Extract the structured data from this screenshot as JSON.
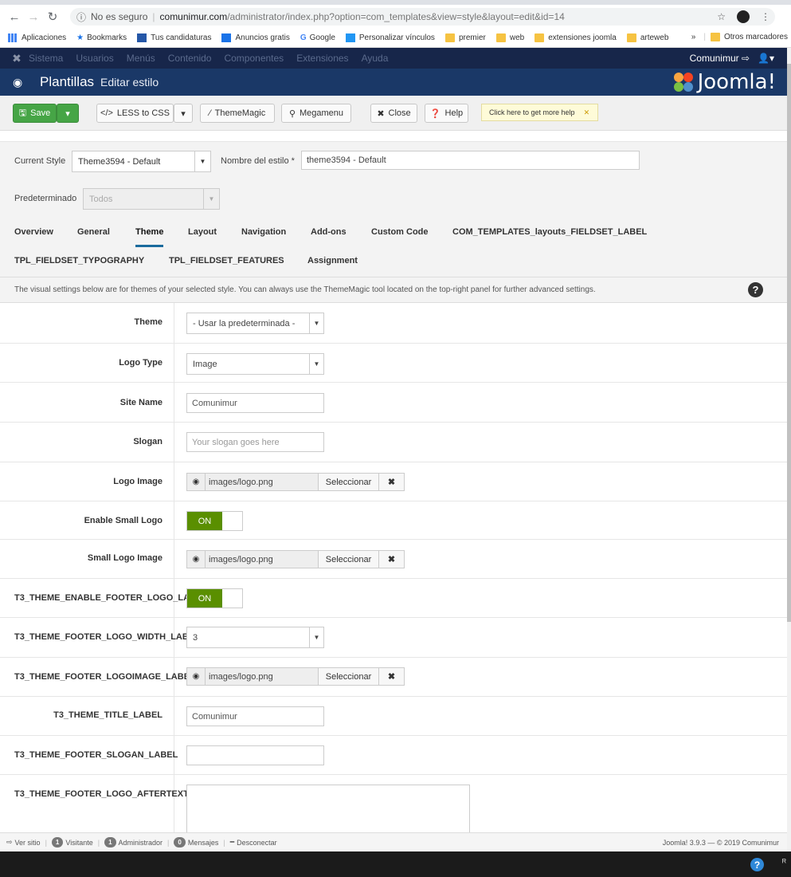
{
  "browser": {
    "url_warning": "No es seguro",
    "url_host": "comunimur.com",
    "url_path": "/administrator/index.php?option=com_templates&view=style&layout=edit&id=14",
    "bookmarks": [
      "Aplicaciones",
      "Bookmarks",
      "Tus candidaturas",
      "Anuncios gratis",
      "Google",
      "Personalizar vínculos",
      "premier",
      "web",
      "extensiones joomla",
      "arteweb"
    ],
    "more": "»",
    "other_bookmarks": "Otros marcadores"
  },
  "menu": {
    "items": [
      "Sistema",
      "Usuarios",
      "Menús",
      "Contenido",
      "Componentes",
      "Extensiones",
      "Ayuda"
    ],
    "user": "Comunimur"
  },
  "title": {
    "main": "Plantillas",
    "sub": "Editar estilo",
    "brand": "Joomla!"
  },
  "toolbar": {
    "save": "Save",
    "less": "LESS to CSS",
    "thememagic": "ThemeMagic",
    "megamenu": "Megamenu",
    "close": "Close",
    "help": "Help",
    "tip": "Click here to get more help"
  },
  "style": {
    "current_label": "Current Style",
    "current_value": "Theme3594 - Default",
    "name_label": "Nombre del estilo *",
    "name_value": "theme3594 - Default",
    "default_label": "Predeterminado",
    "default_value": "Todos"
  },
  "tabs": [
    "Overview",
    "General",
    "Theme",
    "Layout",
    "Navigation",
    "Add-ons",
    "Custom Code",
    "COM_TEMPLATES_layouts_FIELDSET_LABEL",
    "TPL_FIELDSET_TYPOGRAPHY",
    "TPL_FIELDSET_FEATURES",
    "Assignment"
  ],
  "notice": "The visual settings below are for themes of your selected style. You can always use the ThemeMagic tool located on the top-right panel for further advanced settings.",
  "fields": {
    "theme": {
      "label": "Theme",
      "value": "- Usar la predeterminada -"
    },
    "logo_type": {
      "label": "Logo Type",
      "value": "Image"
    },
    "site_name": {
      "label": "Site Name",
      "value": "Comunimur"
    },
    "slogan": {
      "label": "Slogan",
      "placeholder": "Your slogan goes here"
    },
    "logo_image": {
      "label": "Logo Image",
      "value": "images/logo.png"
    },
    "enable_small_logo": {
      "label": "Enable Small Logo",
      "value": "ON"
    },
    "small_logo_image": {
      "label": "Small Logo Image",
      "value": "images/logo.png"
    },
    "footer_logo_enable": {
      "label": "T3_THEME_ENABLE_FOOTER_LOGO_LA",
      "value": "ON"
    },
    "footer_logo_width": {
      "label": "T3_THEME_FOOTER_LOGO_WIDTH_LAB",
      "value": "3"
    },
    "footer_logo_image": {
      "label": "T3_THEME_FOOTER_LOGOIMAGE_LABE",
      "value": "images/logo.png"
    },
    "title_label": {
      "label": "T3_THEME_TITLE_LABEL",
      "value": "Comunimur"
    },
    "footer_slogan": {
      "label": "T3_THEME_FOOTER_SLOGAN_LABEL",
      "value": ""
    },
    "footer_aftertext": {
      "label": "T3_THEME_FOOTER_LOGO_AFTERTEXT",
      "value": ""
    },
    "select_label": "Seleccionar"
  },
  "status": {
    "view_site": "Ver sitio",
    "visitors_count": "1",
    "visitors": "Visitante",
    "admins_count": "1",
    "admins": "Administrador",
    "messages_count": "0",
    "messages": "Mensajes",
    "logout": "Desconectar",
    "version": "Joomla! 3.9.3 — © 2019 Comunimur"
  },
  "colors": {
    "menu_bg": "#17264a",
    "title_bg": "#1a3867",
    "save_green": "#46a546",
    "toggle_green": "#5a8f00"
  }
}
